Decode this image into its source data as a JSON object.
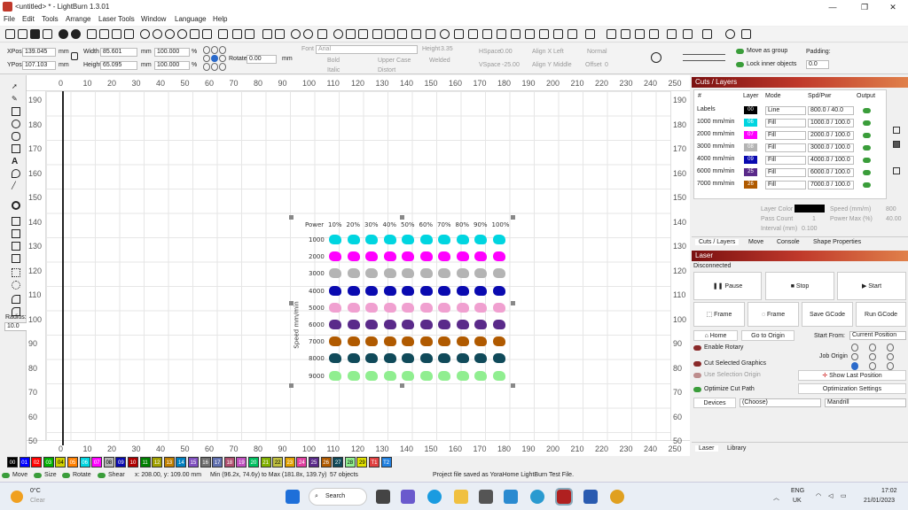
{
  "window": {
    "title": "<untitled> * - LightBurn 1.3.01"
  },
  "menu": [
    "File",
    "Edit",
    "Tools",
    "Arrange",
    "Laser Tools",
    "Window",
    "Language",
    "Help"
  ],
  "props": {
    "xpos_label": "XPos",
    "xpos": "139.045",
    "ypos_label": "YPos",
    "ypos": "107.103",
    "unit": "mm",
    "width_label": "Width",
    "width": "85.601",
    "height_label": "Height",
    "height": "65.095",
    "scale_w": "100.000",
    "scale_h": "100.000",
    "pct": "%",
    "rotate_label": "Rotate",
    "rotate": "0.00",
    "font_label": "Font",
    "font": "Arial",
    "height_t_label": "Height",
    "height_t": "3.35",
    "hspace_label": "HSpace",
    "hspace": "0.00",
    "vspace_label": "VSpace",
    "vspace": "-25.00",
    "alignx_label": "Align X",
    "alignx": "Left",
    "aligny_label": "Align Y",
    "aligny": "Middle",
    "normal": "Normal",
    "offset_label": "Offset",
    "offset": "0",
    "bold": "Bold",
    "italic": "Italic",
    "upper": "Upper Case",
    "distort": "Distort",
    "welded": "Welded",
    "move_group": "Move as group",
    "lock_inner": "Lock inner objects",
    "padding_label": "Padding:",
    "padding": "0.0"
  },
  "left_tools": {
    "radius_label": "Radius:",
    "radius": "10.0"
  },
  "ruler": {
    "top": [
      "0",
      "10",
      "20",
      "30",
      "40",
      "50",
      "60",
      "70",
      "80",
      "90",
      "100",
      "110",
      "120",
      "130",
      "140",
      "150",
      "160",
      "170",
      "180",
      "190",
      "200",
      "210",
      "220",
      "230",
      "240",
      "250"
    ],
    "side": [
      "190",
      "180",
      "170",
      "160",
      "150",
      "140",
      "130",
      "120",
      "110",
      "100",
      "90",
      "80",
      "70",
      "60",
      "50"
    ]
  },
  "grid": {
    "header": "Power",
    "cols": [
      "10%",
      "20%",
      "30%",
      "40%",
      "50%",
      "60%",
      "70%",
      "80%",
      "90%",
      "100%"
    ],
    "rows": [
      "1000",
      "2000",
      "3000",
      "4000",
      "5000",
      "6000",
      "7000",
      "8000",
      "9000"
    ],
    "row_colors": [
      "#00d5e0",
      "#ff00ff",
      "#b4b4b4",
      "#0a0ab0",
      "#f0a0d0",
      "#5a2a8a",
      "#b05a00",
      "#104a5a",
      "#90ee90"
    ],
    "side_label": "Speed mm/min"
  },
  "cuts": {
    "title": "Cuts / Layers",
    "headers": [
      "#",
      "Layer",
      "Mode",
      "Spd/Pwr",
      "Output"
    ],
    "rows": [
      {
        "name": "Labels",
        "layer": "00",
        "color": "#000000",
        "mode": "Line",
        "spd": "800.0 / 40.0"
      },
      {
        "name": "1000 mm/min",
        "layer": "06",
        "color": "#00d5e0",
        "mode": "Fill",
        "spd": "1000.0 / 100.0"
      },
      {
        "name": "2000 mm/min",
        "layer": "07",
        "color": "#ff00ff",
        "mode": "Fill",
        "spd": "2000.0 / 100.0"
      },
      {
        "name": "3000 mm/min",
        "layer": "08",
        "color": "#b4b4b4",
        "mode": "Fill",
        "spd": "3000.0 / 100.0"
      },
      {
        "name": "4000 mm/min",
        "layer": "09",
        "color": "#0a0ab0",
        "mode": "Fill",
        "spd": "4000.0 / 100.0"
      },
      {
        "name": "6000 mm/min",
        "layer": "25",
        "color": "#5a2a8a",
        "mode": "Fill",
        "spd": "6000.0 / 100.0"
      },
      {
        "name": "7000 mm/min",
        "layer": "26",
        "color": "#b05a00",
        "mode": "Fill",
        "spd": "7000.0 / 100.0"
      }
    ],
    "layer_color": "Layer Color",
    "speed_label": "Speed (mm/m)",
    "speed": "800",
    "pass_label": "Pass Count",
    "pass": "1",
    "power_label": "Power Max (%)",
    "power": "40.00",
    "interval_label": "Interval (mm)",
    "interval": "0.100",
    "tabs": [
      "Cuts / Layers",
      "Move",
      "Console",
      "Shape Properties"
    ]
  },
  "laser": {
    "title": "Laser",
    "status": "Disconnected",
    "pause": "Pause",
    "stop": "Stop",
    "start": "Start",
    "frame1": "Frame",
    "frame2": "Frame",
    "save_gcode": "Save GCode",
    "run_gcode": "Run GCode",
    "home": "Home",
    "go_origin": "Go to Origin",
    "start_from_label": "Start From:",
    "start_from": "Current Position",
    "enable_rotary": "Enable Rotary",
    "job_origin": "Job Origin",
    "cut_selected": "Cut Selected Graphics",
    "use_selection": "Use Selection Origin",
    "show_last": "Show Last Position",
    "optimize": "Optimize Cut Path",
    "opt_settings": "Optimization Settings",
    "devices": "Devices",
    "device_choice": "(Choose)",
    "device_name": "Mandrill",
    "tabs": [
      "Laser",
      "Library"
    ]
  },
  "palette": [
    {
      "id": "00",
      "c": "#000000"
    },
    {
      "id": "01",
      "c": "#0000ff"
    },
    {
      "id": "02",
      "c": "#ff0000"
    },
    {
      "id": "03",
      "c": "#00b000"
    },
    {
      "id": "04",
      "c": "#d0d000"
    },
    {
      "id": "05",
      "c": "#ff8000"
    },
    {
      "id": "06",
      "c": "#00d5e0"
    },
    {
      "id": "07",
      "c": "#ff00ff"
    },
    {
      "id": "08",
      "c": "#b4b4b4"
    },
    {
      "id": "09",
      "c": "#0a0ab0"
    },
    {
      "id": "10",
      "c": "#b00000"
    },
    {
      "id": "11",
      "c": "#008000"
    },
    {
      "id": "12",
      "c": "#a0a000"
    },
    {
      "id": "13",
      "c": "#c08000"
    },
    {
      "id": "14",
      "c": "#0080c0"
    },
    {
      "id": "15",
      "c": "#8050c0"
    },
    {
      "id": "16",
      "c": "#707070"
    },
    {
      "id": "17",
      "c": "#6070b0"
    },
    {
      "id": "18",
      "c": "#b05070"
    },
    {
      "id": "19",
      "c": "#c050c0"
    },
    {
      "id": "20",
      "c": "#00c060"
    },
    {
      "id": "21",
      "c": "#80b000"
    },
    {
      "id": "22",
      "c": "#c0c040"
    },
    {
      "id": "23",
      "c": "#e0a000"
    },
    {
      "id": "24",
      "c": "#e040a0"
    },
    {
      "id": "25",
      "c": "#5a2a8a"
    },
    {
      "id": "26",
      "c": "#b05a00"
    },
    {
      "id": "27",
      "c": "#104a5a"
    },
    {
      "id": "28",
      "c": "#90ee90"
    },
    {
      "id": "29",
      "c": "#e0e000"
    },
    {
      "id": "T1",
      "c": "#e04040"
    },
    {
      "id": "T2",
      "c": "#2080e0"
    }
  ],
  "status": {
    "move": "Move",
    "size": "Size",
    "rotate": "Rotate",
    "shear": "Shear",
    "coords": "x: 208.00, y: 109.00 mm",
    "range": "Min (96.2x, 74.6y) to Max (181.8x, 139.7y)",
    "objects": "57 objects",
    "message": "Project file saved as YoraHome LightBurn Test File."
  },
  "taskbar": {
    "weather_temp": "0°C",
    "weather": "Clear",
    "search": "Search",
    "lang": "ENG",
    "region": "UK",
    "time": "17:02",
    "date": "21/01/2023"
  }
}
